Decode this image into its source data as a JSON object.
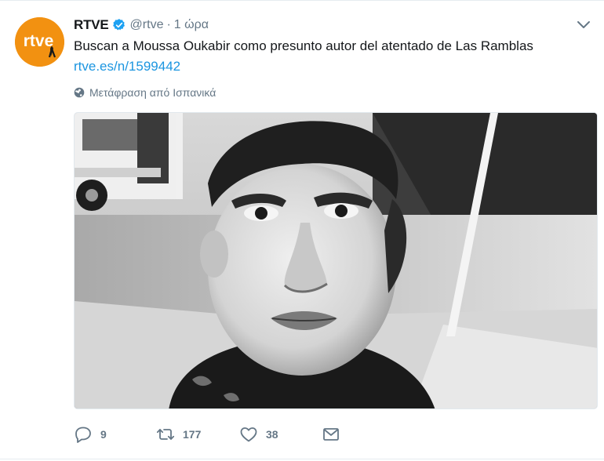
{
  "tweet": {
    "author_name": "RTVE",
    "handle": "@rtve",
    "separator": "·",
    "time": "1 ώρα",
    "text": "Buscan a Moussa Oukabir como presunto autor del atentado de Las Ramblas",
    "link": "rtve.es/n/1599442",
    "translate_label": "Μετάφραση από Ισπανικά",
    "avatar_text": "rtve",
    "icons": {
      "verified": "verified-badge-icon",
      "caret": "chevron-down-icon",
      "globe": "globe-icon",
      "reply": "reply-icon",
      "retweet": "retweet-icon",
      "like": "heart-icon",
      "dm": "envelope-icon"
    }
  },
  "actions": {
    "reply_count": "9",
    "retweet_count": "177",
    "like_count": "38"
  },
  "colors": {
    "brand_orange": "#f29111",
    "verified_blue": "#1da1f2",
    "link_blue": "#1b95e0",
    "muted_gray": "#657786"
  }
}
